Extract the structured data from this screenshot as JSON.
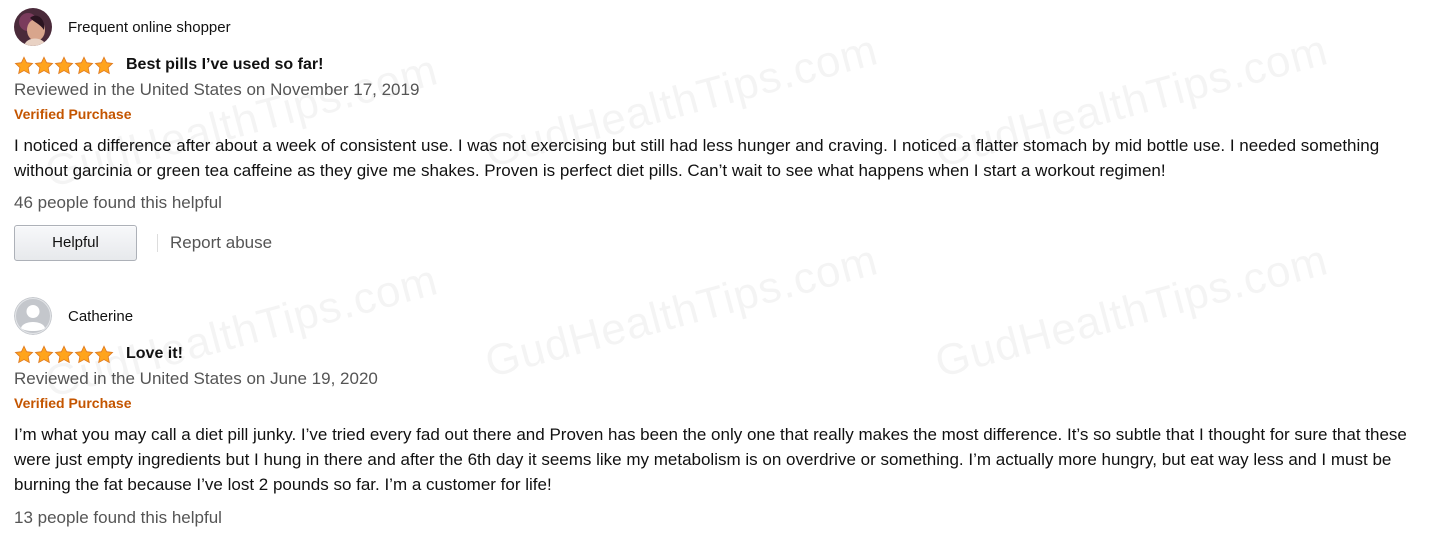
{
  "reviews": [
    {
      "profile_name": "Frequent online shopper",
      "avatar": "profile-photo",
      "rating": 5,
      "title": "Best pills I’ve used so far!",
      "date": "Reviewed in the United States on November 17, 2019",
      "verified": "Verified Purchase",
      "body": "I noticed a difference after about a week of consistent use. I was not exercising but still had less hunger and craving. I noticed a flatter stomach by mid bottle use. I needed something without garcinia or green tea caffeine as they give me shakes. Proven is perfect diet pills. Can’t wait to see what happens when I start a workout regimen!",
      "helpful_count": "46 people found this helpful",
      "helpful_button": "Helpful",
      "report_link": "Report abuse"
    },
    {
      "profile_name": "Catherine",
      "avatar": "default-avatar-icon",
      "rating": 5,
      "title": "Love it!",
      "date": "Reviewed in the United States on June 19, 2020",
      "verified": "Verified Purchase",
      "body": "I’m what you may call a diet pill junky. I’ve tried every fad out there and Proven has been the only one that really makes the most difference. It’s so subtle that I thought for sure that these were just empty ingredients but I hung in there and after the 6th day it seems like my metabolism is on overdrive or something. I’m actually more hungry, but eat way less and I must be burning the fat because I’ve lost 2 pounds so far. I’m a customer for life!",
      "helpful_count": "13 people found this helpful"
    }
  ],
  "watermark": "GudHealthTips.com",
  "colors": {
    "star": "#ffa41c",
    "verified": "#c45500",
    "muted_text": "#555555"
  }
}
